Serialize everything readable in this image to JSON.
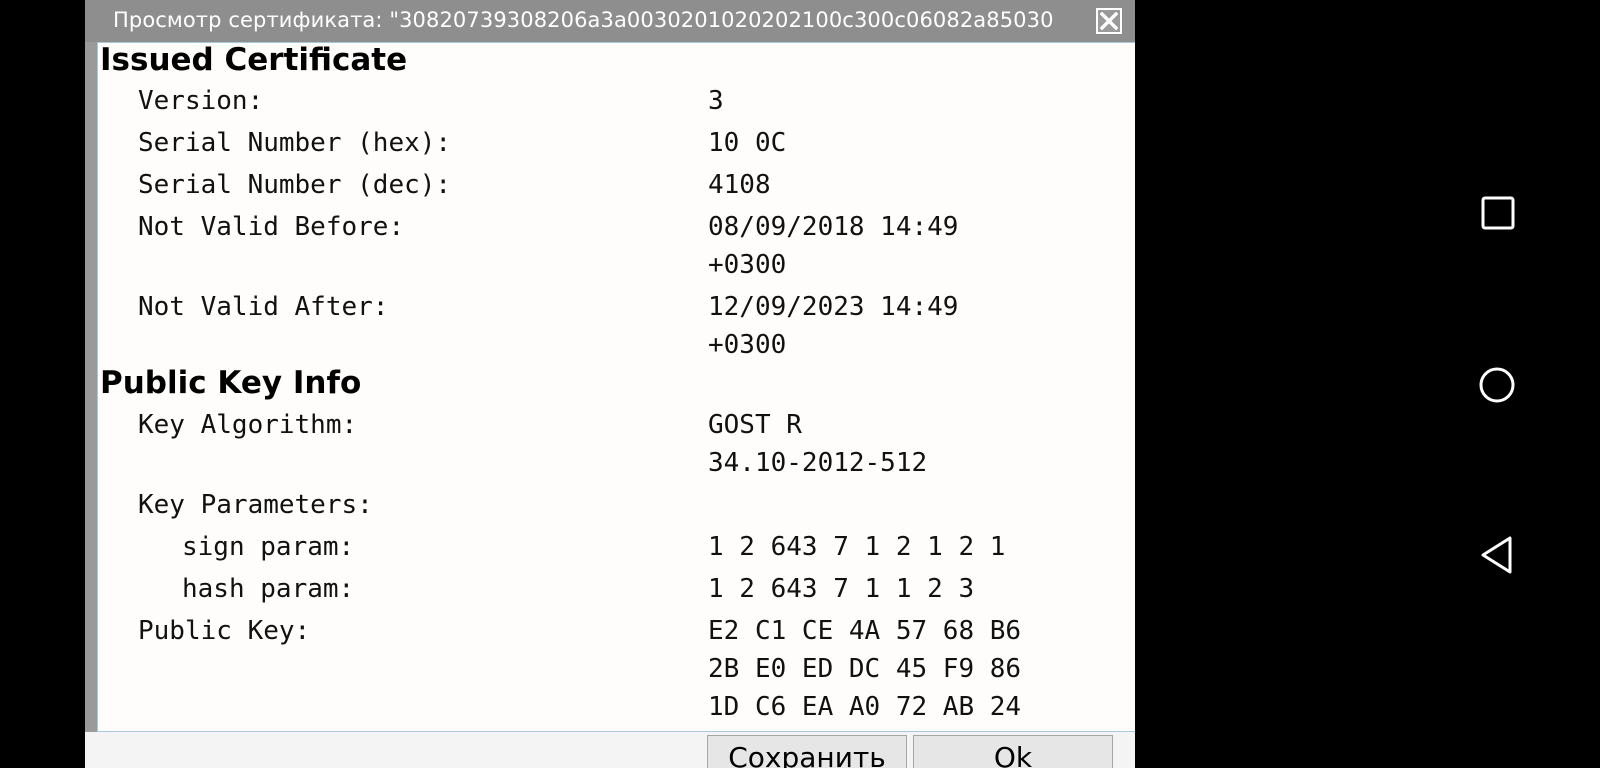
{
  "dialog": {
    "title": "Просмотр сертификата: \"30820739308206a3a0030201020202100c300c06082a85030",
    "close_icon": "close-icon"
  },
  "sections": {
    "issued": {
      "title": "Issued Certificate",
      "rows": [
        {
          "label": "Version:",
          "value_lines": [
            "3"
          ]
        },
        {
          "label": "Serial Number (hex):",
          "value_lines": [
            "10 0C"
          ]
        },
        {
          "label": "Serial Number (dec):",
          "value_lines": [
            "4108"
          ]
        },
        {
          "label": "Not Valid Before:",
          "value_lines": [
            "08/09/2018 14:49",
            "+0300"
          ]
        },
        {
          "label": "Not Valid After:",
          "value_lines": [
            "12/09/2023 14:49",
            "+0300"
          ]
        }
      ]
    },
    "public_key": {
      "title": "Public Key Info",
      "rows": [
        {
          "label": "Key Algorithm:",
          "value_lines": [
            "GOST R",
            "34.10-2012-512"
          ]
        },
        {
          "label": "Key Parameters:",
          "value_lines": []
        },
        {
          "label": "sign param:",
          "value_lines": [
            "1 2 643 7 1 2 1 2 1"
          ]
        },
        {
          "label": "hash param:",
          "value_lines": [
            "1 2 643 7 1 1 2 3"
          ]
        },
        {
          "label": "Public Key:",
          "value_lines": [
            "E2 C1 CE 4A 57 68 B6",
            "2B E0 ED DC 45 F9 86",
            "1D C6 EA A0 72 AB 24"
          ]
        }
      ]
    }
  },
  "buttons": {
    "save": "Сохранить",
    "ok": "Ok"
  },
  "navbar": {
    "icons": [
      "recents-square-icon",
      "home-circle-icon",
      "back-triangle-icon"
    ]
  }
}
